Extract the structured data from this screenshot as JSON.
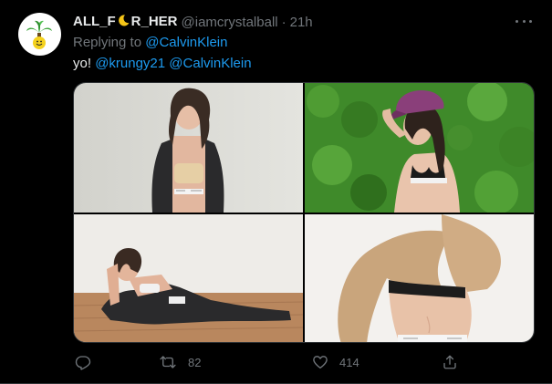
{
  "tweet": {
    "display_name_left": "ALL_F",
    "display_name_right": "R_HER",
    "handle": "@iamcrystalball",
    "separator": "·",
    "time": "21h",
    "replying_label": "Replying to",
    "replying_to": "@CalvinKlein",
    "text_prefix": "yo!",
    "mention_1": "@krungy21",
    "mention_2": "@CalvinKlein"
  },
  "stats": {
    "retweets": "82",
    "likes": "414"
  },
  "icons": {
    "avatar": "palm-tree-smiley-icon",
    "name_emoji": "crescent-moon-icon",
    "more": "more-dots-icon",
    "reply": "reply-icon",
    "retweet": "retweet-icon",
    "like": "heart-icon",
    "share": "share-icon"
  },
  "colors": {
    "background": "#000000",
    "primary_text": "#e7e9ea",
    "secondary_text": "#71767b",
    "link": "#1d9bf0",
    "border": "#2f3336"
  }
}
